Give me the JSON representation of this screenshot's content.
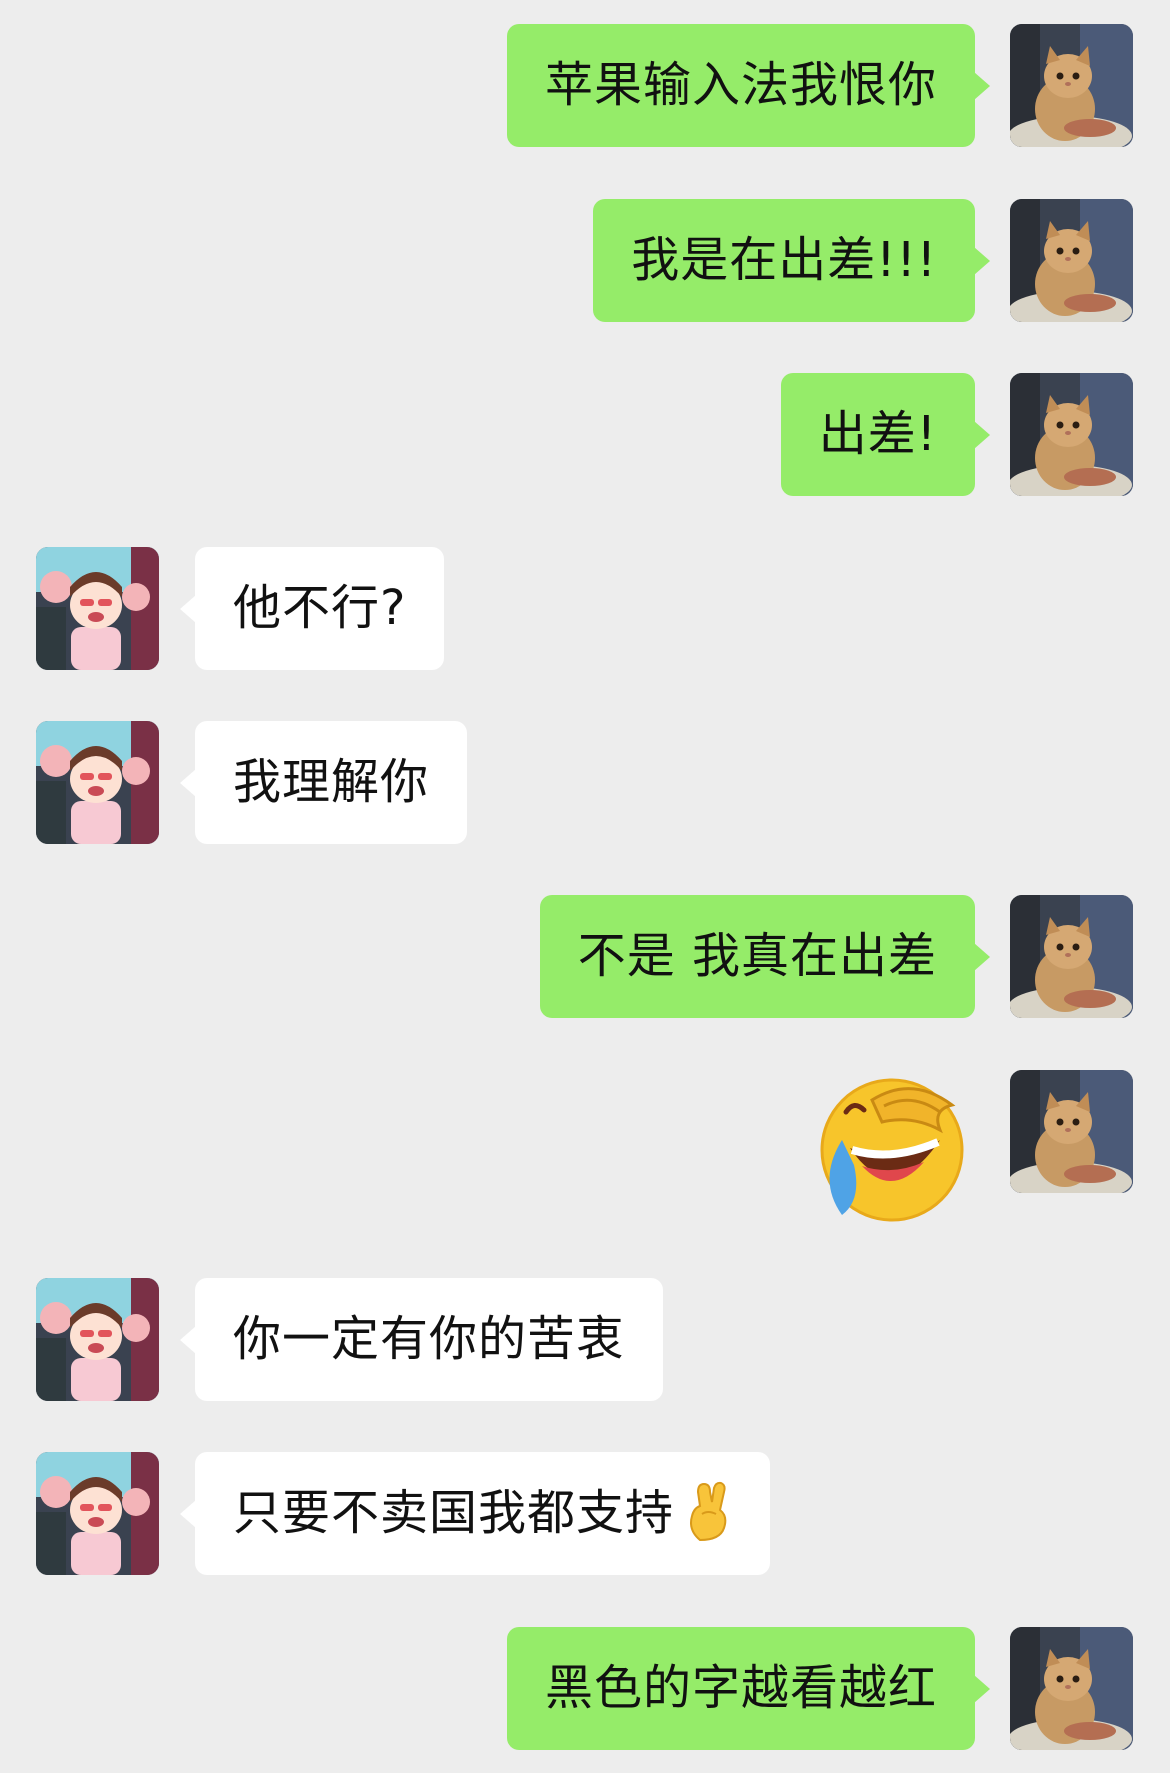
{
  "conversation": {
    "messages": [
      {
        "sender": "me",
        "text": "苹果输入法我恨你"
      },
      {
        "sender": "me",
        "text": "我是在出差!!!"
      },
      {
        "sender": "me",
        "text": "出差!"
      },
      {
        "sender": "friend",
        "text": "他不行?"
      },
      {
        "sender": "friend",
        "text": "我理解你"
      },
      {
        "sender": "me",
        "text": "不是 我真在出差"
      },
      {
        "sender": "me",
        "sticker": "laughing-crying-facepalm-emoji"
      },
      {
        "sender": "friend",
        "text": "你一定有你的苦衷"
      },
      {
        "sender": "friend",
        "text": "只要不卖国我都支持",
        "trailing_emoji": "crossed-fingers-emoji"
      },
      {
        "sender": "me",
        "text": "黑色的字越看越红"
      }
    ]
  },
  "colors": {
    "background": "#ededed",
    "outgoing_bubble": "#95ec69",
    "incoming_bubble": "#ffffff",
    "text": "#111111"
  },
  "avatars": {
    "me": "kitten-avatar",
    "friend": "cartoon-girl-avatar"
  }
}
